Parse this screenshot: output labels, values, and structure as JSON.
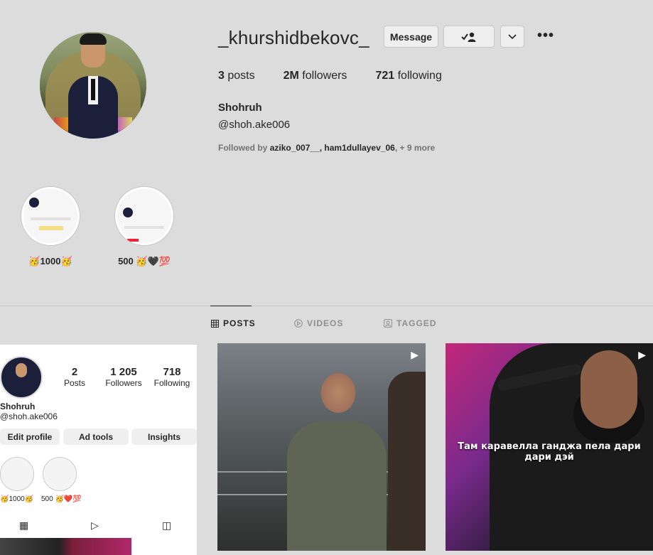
{
  "profile": {
    "username": "_khurshidbekovc_",
    "message_label": "Message",
    "posts_count": "3",
    "posts_label": "posts",
    "followers_count": "2M",
    "followers_label": "followers",
    "following_count": "721",
    "following_label": "following",
    "full_name": "Shohruh",
    "handle": "@shoh.ake006",
    "followed_by_prefix": "Followed by",
    "followed_by_names": "aziko_007__, ham1dullayev_06",
    "followed_by_more": ", + 9 more"
  },
  "highlights": [
    {
      "label": "🥳1000🥳"
    },
    {
      "label": "500 🥳🖤💯"
    }
  ],
  "tabs": [
    {
      "label": "POSTS",
      "active": true
    },
    {
      "label": "VIDEOS",
      "active": false
    },
    {
      "label": "TAGGED",
      "active": false
    }
  ],
  "phone": {
    "posts_count": "2",
    "posts_label": "Posts",
    "followers_count": "1 205",
    "followers_label": "Followers",
    "following_count": "718",
    "following_label": "Following",
    "name": "Shohruh",
    "handle": "@shoh.ake006",
    "edit_profile": "Edit profile",
    "ad_tools": "Ad tools",
    "insights": "Insights",
    "highlight1": "🥳1000🥳",
    "highlight2": "500 🥳❤️💯"
  },
  "posts": [
    {
      "caption": ""
    },
    {
      "caption": "Там каравелла ганджа пела дари дари дэй"
    }
  ]
}
